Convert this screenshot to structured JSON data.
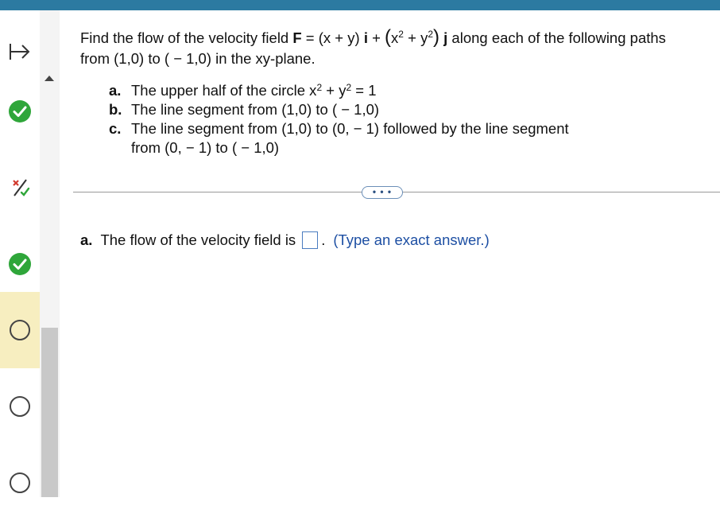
{
  "sidebar": {
    "items": [
      {
        "status": "correct",
        "icon": "check-circle-icon"
      },
      {
        "status": "partial",
        "icon": "partial-credit-icon"
      },
      {
        "status": "correct",
        "icon": "check-circle-icon"
      },
      {
        "status": "current",
        "icon": "empty-circle-icon"
      },
      {
        "status": "unanswered",
        "icon": "empty-circle-icon"
      },
      {
        "status": "unanswered",
        "icon": "empty-circle-icon"
      }
    ],
    "colors": {
      "correct": "#2fa63a",
      "active_bg": "#f7eec0",
      "topbar": "#2c7aa1"
    }
  },
  "question": {
    "intro": "Find the flow of the velocity field",
    "F": "F",
    "eq": " = (x + y) ",
    "i": "i",
    "plus": " + ",
    "x": "x",
    "exp2a": "2",
    "plus2": " + y",
    "exp2b": "2",
    "j": "j",
    "tail": " along each of the following paths",
    "line2": "from (1,0) to ( − 1,0) in the xy-plane.",
    "parts": [
      {
        "label": "a.",
        "text_pre": "The upper half of the circle x",
        "exp": "2",
        "text_mid": " + y",
        "exp2": "2",
        "text_post": " = 1"
      },
      {
        "label": "b.",
        "text": "The line segment from (1,0) to ( − 1,0)"
      },
      {
        "label": "c.",
        "text": "The line segment from (1,0) to (0, − 1) followed by the line segment",
        "text2": "from (0, − 1) to ( − 1,0)"
      }
    ]
  },
  "expand_button": "• • •",
  "answer": {
    "label": "a.",
    "text": "The flow of the velocity field is",
    "after": ".",
    "hint": "(Type an exact answer.)"
  }
}
